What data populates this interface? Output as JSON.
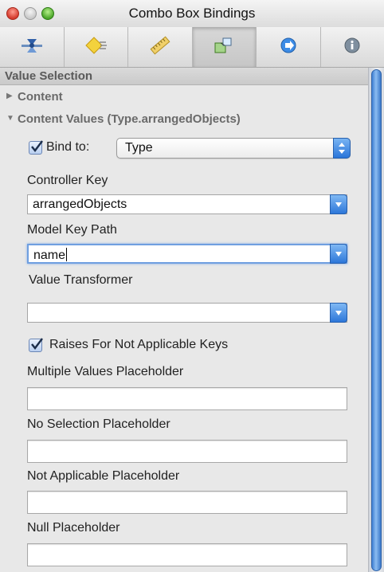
{
  "window": {
    "title": "Combo Box Bindings"
  },
  "toolbar": {
    "tabs": [
      {
        "icon": "attributes-inspector-icon",
        "active": false
      },
      {
        "icon": "effects-inspector-icon",
        "active": false
      },
      {
        "icon": "size-inspector-icon",
        "active": false
      },
      {
        "icon": "bindings-inspector-icon",
        "active": true
      },
      {
        "icon": "connections-inspector-icon",
        "active": false
      },
      {
        "icon": "identity-inspector-icon",
        "active": false
      }
    ]
  },
  "section": {
    "title": "Value Selection",
    "content_row": "Content",
    "content_values_row": "Content Values (Type.arrangedObjects)"
  },
  "bind_to": {
    "label": "Bind to:",
    "checked": true,
    "value": "Type"
  },
  "controller_key": {
    "label": "Controller Key",
    "value": "arrangedObjects"
  },
  "model_key_path": {
    "label": "Model Key Path",
    "value": "name"
  },
  "value_transformer": {
    "label": "Value Transformer",
    "value": ""
  },
  "raises_for_not_applicable": {
    "label": "Raises For Not Applicable Keys",
    "checked": true
  },
  "placeholders": {
    "multiple_values": {
      "label": "Multiple Values Placeholder",
      "value": ""
    },
    "no_selection": {
      "label": "No Selection Placeholder",
      "value": ""
    },
    "not_applicable": {
      "label": "Not Applicable Placeholder",
      "value": ""
    },
    "null": {
      "label": "Null Placeholder",
      "value": ""
    }
  },
  "colors": {
    "accent_blue": "#2a75d9",
    "focus_ring": "#6f9fe0",
    "close_red": "#d43a2c",
    "zoom_green": "#4aa528"
  }
}
